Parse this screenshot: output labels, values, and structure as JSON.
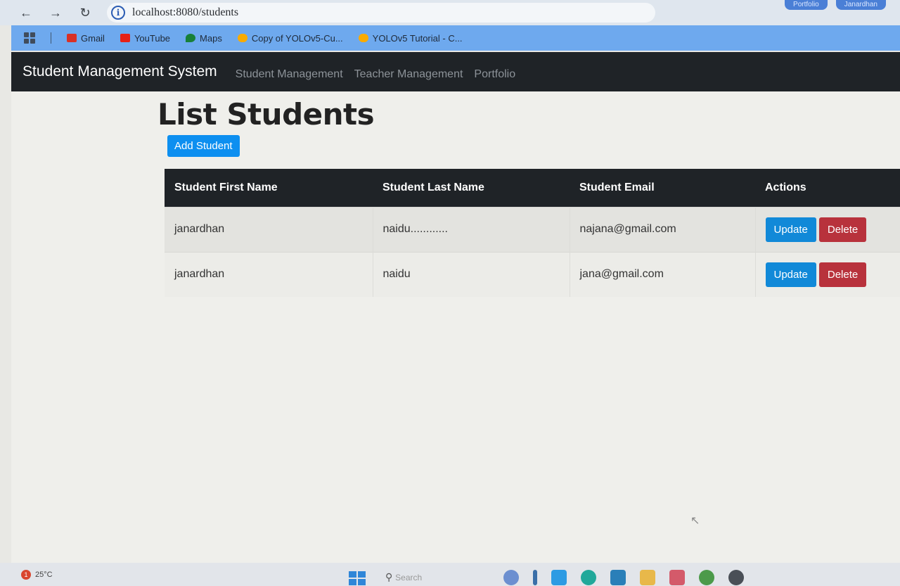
{
  "browser": {
    "url": "localhost:8080/students",
    "top_right": [
      "Portfolio",
      "Janardhan"
    ]
  },
  "bookmarks": [
    {
      "label": "Gmail",
      "color": "#d93025"
    },
    {
      "label": "YouTube",
      "color": "#e62117"
    },
    {
      "label": "Maps",
      "color": "#188038"
    },
    {
      "label": "Copy of YOLOv5-Cu...",
      "color": "#f9ab00"
    },
    {
      "label": "YOLOv5 Tutorial - C...",
      "color": "#f9ab00"
    }
  ],
  "navbar": {
    "brand": "Student Management System",
    "links": [
      "Student Management",
      "Teacher Management",
      "Portfolio"
    ]
  },
  "page": {
    "title": "List Students",
    "add_button": "Add Student"
  },
  "table": {
    "headers": [
      "Student First Name",
      "Student Last Name",
      "Student Email",
      "Actions"
    ],
    "rows": [
      {
        "first": "janardhan",
        "last": "naidu............",
        "email": "najana@gmail.com"
      },
      {
        "first": "janardhan",
        "last": "naidu",
        "email": "jana@gmail.com"
      }
    ],
    "update_label": "Update",
    "delete_label": "Delete"
  },
  "taskbar": {
    "weather": "25°C",
    "weather_badge": "1",
    "search_placeholder": "Search"
  },
  "colors": {
    "navbar_bg": "#1f2327",
    "primary": "#0d8ff0",
    "danger": "#b8323c"
  }
}
